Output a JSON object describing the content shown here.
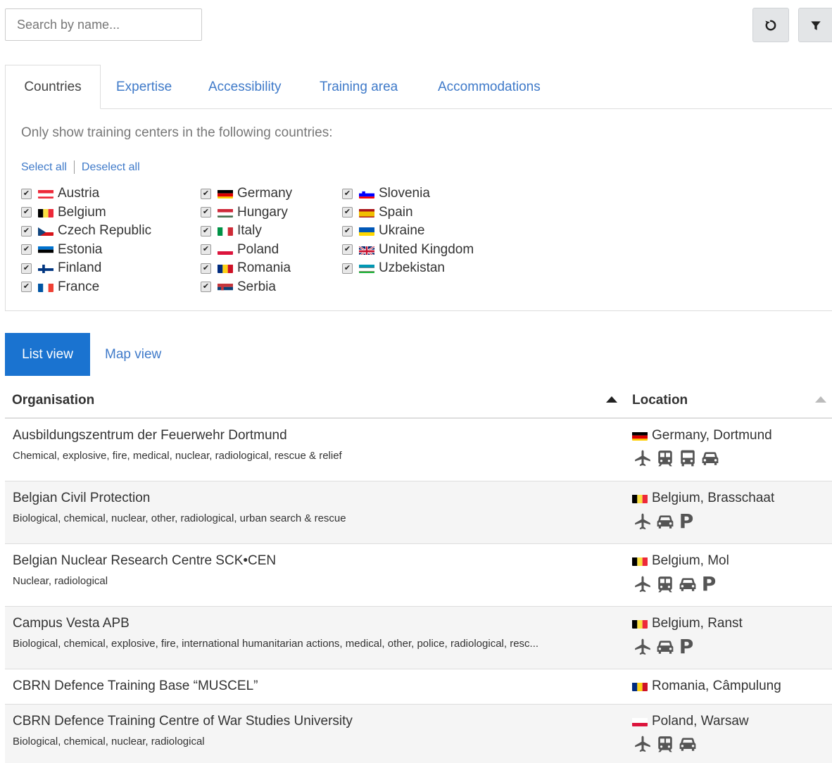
{
  "search": {
    "placeholder": "Search by name..."
  },
  "toolbar": {
    "reset_icon": "reset-icon",
    "filter_icon": "filter-icon"
  },
  "filter_tabs": [
    "Countries",
    "Expertise",
    "Accessibility",
    "Training area",
    "Accommodations"
  ],
  "countries_panel": {
    "description": "Only show training centers in the following countries:",
    "select_all": "Select all",
    "deselect_all": "Deselect all",
    "columns": [
      [
        "Austria",
        "Belgium",
        "Czech Republic",
        "Estonia",
        "Finland",
        "France"
      ],
      [
        "Germany",
        "Hungary",
        "Italy",
        "Poland",
        "Romania",
        "Serbia"
      ],
      [
        "Slovenia",
        "Spain",
        "Ukraine",
        "United Kingdom",
        "Uzbekistan"
      ]
    ],
    "checkmark": "✔"
  },
  "view_tabs": {
    "list": "List view",
    "map": "Map view"
  },
  "table": {
    "headers": {
      "organisation": "Organisation",
      "location": "Location"
    },
    "rows": [
      {
        "name": "Ausbildungszentrum der Feuerwehr Dortmund",
        "tags": "Chemical, explosive, fire, medical, nuclear, radiological, rescue & relief",
        "location": "Germany, Dortmund",
        "flag": "germany",
        "amenities": [
          "plane-icon",
          "train-icon",
          "bus-icon",
          "car-icon"
        ]
      },
      {
        "name": "Belgian Civil Protection",
        "tags": "Biological, chemical, nuclear, other, radiological, urban search & rescue",
        "location": "Belgium, Brasschaat",
        "flag": "belgium",
        "amenities": [
          "plane-icon",
          "car-icon",
          "parking-icon"
        ]
      },
      {
        "name": "Belgian Nuclear Research Centre SCK•CEN",
        "tags": "Nuclear, radiological",
        "location": "Belgium, Mol",
        "flag": "belgium",
        "amenities": [
          "plane-icon",
          "train-icon",
          "car-icon",
          "parking-icon"
        ]
      },
      {
        "name": "Campus Vesta APB",
        "tags": "Biological, chemical, explosive, fire, international humanitarian actions, medical, other, police, radiological, resc...",
        "location": "Belgium, Ranst",
        "flag": "belgium",
        "amenities": [
          "plane-icon",
          "car-icon",
          "parking-icon"
        ]
      },
      {
        "name": "CBRN Defence Training Base “MUSCEL”",
        "tags": "",
        "location": "Romania, Câmpulung",
        "flag": "romania",
        "amenities": []
      },
      {
        "name": "CBRN Defence Training Centre of War Studies University",
        "tags": "Biological, chemical, nuclear, radiological",
        "location": "Poland, Warsaw",
        "flag": "poland",
        "amenities": [
          "plane-icon",
          "train-icon",
          "car-icon"
        ]
      }
    ]
  },
  "parking_label": "P"
}
